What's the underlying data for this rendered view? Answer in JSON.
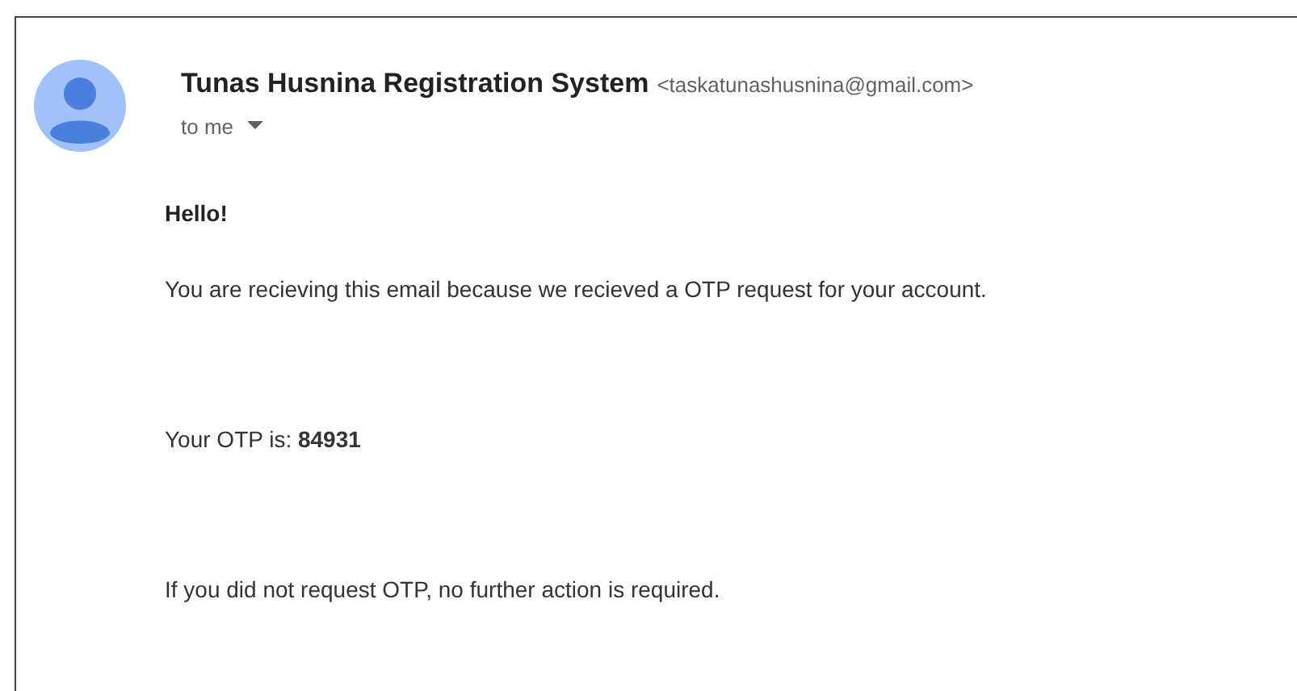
{
  "sender": {
    "name": "Tunas Husnina Registration System",
    "address": "<taskatunashusnina@gmail.com>"
  },
  "recipient": {
    "label": "to me"
  },
  "body": {
    "greeting": "Hello!",
    "paragraphs": [
      "You are recieving this email because we recieved a OTP request for your account.",
      "Your OTP is: **84931**",
      "If you did not request OTP, no further action is required."
    ]
  }
}
